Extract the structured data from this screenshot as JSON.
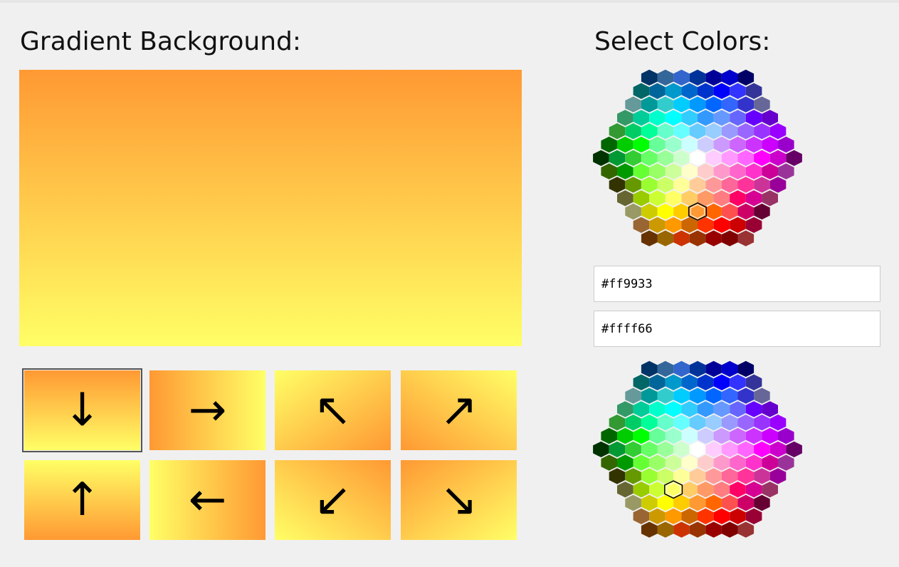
{
  "headings": {
    "gradient_background": "Gradient Background:",
    "select_colors": "Select Colors:"
  },
  "colors": {
    "color1": "#ff9933",
    "color2": "#ffff66"
  },
  "preview": {
    "direction": "to bottom"
  },
  "directions": [
    {
      "arrow": "↓",
      "css": "to bottom",
      "selected": true
    },
    {
      "arrow": "→",
      "css": "to right",
      "selected": false
    },
    {
      "arrow": "↖",
      "css": "to top left",
      "selected": false
    },
    {
      "arrow": "↗",
      "css": "to top right",
      "selected": false
    },
    {
      "arrow": "↑",
      "css": "to top",
      "selected": false
    },
    {
      "arrow": "←",
      "css": "to left",
      "selected": false
    },
    {
      "arrow": "↙",
      "css": "to bottom left",
      "selected": false
    },
    {
      "arrow": "↘",
      "css": "to bottom right",
      "selected": false
    }
  ],
  "palette_rows": [
    [
      "#003366",
      "#336699",
      "#3366cc",
      "#003399",
      "#000099",
      "#0000cc",
      "#000066"
    ],
    [
      "#006666",
      "#006699",
      "#0099cc",
      "#0066cc",
      "#0033cc",
      "#0000ff",
      "#3333ff",
      "#333399"
    ],
    [
      "#669999",
      "#009999",
      "#33cccc",
      "#00ccff",
      "#0099ff",
      "#0066ff",
      "#3366ff",
      "#3333cc",
      "#666699"
    ],
    [
      "#339966",
      "#00cc99",
      "#00ffcc",
      "#00ffff",
      "#33ccff",
      "#3399ff",
      "#6699ff",
      "#6666ff",
      "#6600ff",
      "#6600cc"
    ],
    [
      "#339933",
      "#00cc66",
      "#00ff99",
      "#66ffcc",
      "#66ffff",
      "#66ccff",
      "#99ccff",
      "#9999ff",
      "#9966ff",
      "#9933ff",
      "#9900ff"
    ],
    [
      "#006600",
      "#00cc00",
      "#00ff00",
      "#66ff99",
      "#99ffcc",
      "#ccffff",
      "#ccccff",
      "#cc99ff",
      "#cc66ff",
      "#cc33ff",
      "#cc00ff",
      "#9900cc"
    ],
    [
      "#003300",
      "#009933",
      "#33cc33",
      "#66ff66",
      "#99ff99",
      "#ccffcc",
      "#ffffff",
      "#ffccff",
      "#ff99ff",
      "#ff66ff",
      "#ff00ff",
      "#cc00cc",
      "#660066"
    ],
    [
      "#336600",
      "#009900",
      "#66ff33",
      "#99ff66",
      "#ccff99",
      "#ffffcc",
      "#ffcccc",
      "#ff99cc",
      "#ff66cc",
      "#ff33cc",
      "#cc0099",
      "#993399"
    ],
    [
      "#333300",
      "#669900",
      "#99ff33",
      "#ccff66",
      "#ffff99",
      "#ffcc99",
      "#ff9999",
      "#ff6699",
      "#ff3399",
      "#cc3399",
      "#990099"
    ],
    [
      "#666633",
      "#99cc00",
      "#ccff33",
      "#ffff66",
      "#ffcc66",
      "#ff9966",
      "#ff7c80",
      "#ff0066",
      "#d60093",
      "#993366"
    ],
    [
      "#999966",
      "#cccc00",
      "#ffff00",
      "#ffcc00",
      "#ff9933",
      "#ff6600",
      "#ff5050",
      "#cc0066",
      "#660033"
    ],
    [
      "#996633",
      "#cc9900",
      "#ff9900",
      "#cc6600",
      "#ff3300",
      "#ff0000",
      "#cc0000",
      "#990033"
    ],
    [
      "#663300",
      "#996600",
      "#cc3300",
      "#993300",
      "#990000",
      "#800000",
      "#993333"
    ]
  ]
}
